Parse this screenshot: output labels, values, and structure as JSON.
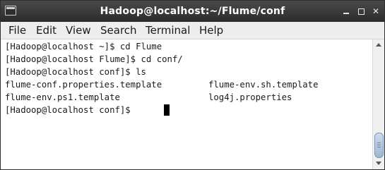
{
  "window": {
    "title": "Hadoop@localhost:~/Flume/conf"
  },
  "icons": {
    "app": "terminal-icon",
    "minimize": "minimize-icon",
    "maximize": "maximize-icon",
    "close": "close-icon",
    "close_glyph": "✕"
  },
  "menu": {
    "items": [
      "File",
      "Edit",
      "View",
      "Search",
      "Terminal",
      "Help"
    ]
  },
  "terminal": {
    "lines": [
      "[Hadoop@localhost ~]$ cd Flume",
      "[Hadoop@localhost Flume]$ cd conf/",
      "[Hadoop@localhost conf]$ ls"
    ],
    "ls_output": [
      [
        "flume-conf.properties.template",
        "flume-env.sh.template"
      ],
      [
        "flume-env.ps1.template",
        "log4j.properties"
      ]
    ],
    "prompt": "[Hadoop@localhost conf]$ "
  },
  "colors": {
    "titlebar": "#2b2b2b",
    "title_text": "#ffffff",
    "terminal_bg": "#ffffff",
    "terminal_text": "#1a1a1a",
    "cursor": "#000000",
    "scroll_thumb": "#9fb5cf"
  }
}
